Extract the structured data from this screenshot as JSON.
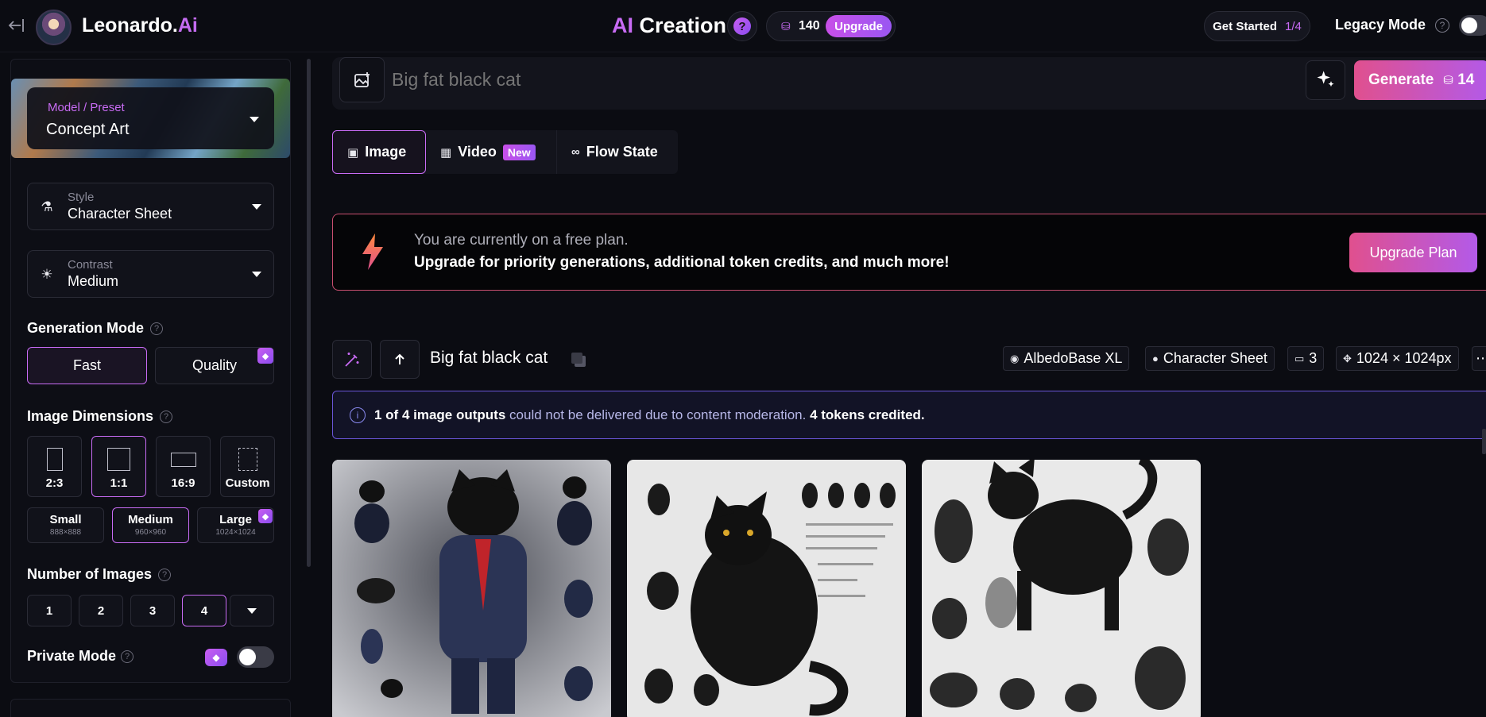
{
  "header": {
    "brand": "Leonardo.",
    "brand_ai": "Ai",
    "title_prefix": "AI",
    "title_main": "Creation",
    "help_label": "?",
    "tokens": "140",
    "upgrade_label": "Upgrade",
    "get_started": "Get Started",
    "get_started_progress": "1/4",
    "legacy_mode": "Legacy Mode"
  },
  "sidebar": {
    "preset_label": "Model / Preset",
    "preset_value": "Concept Art",
    "style_label": "Style",
    "style_value": "Character Sheet",
    "contrast_label": "Contrast",
    "contrast_value": "Medium",
    "generation_mode_title": "Generation Mode",
    "mode_fast": "Fast",
    "mode_quality": "Quality",
    "image_dimensions_title": "Image Dimensions",
    "ratios": [
      "2:3",
      "1:1",
      "16:9",
      "Custom"
    ],
    "sizes": [
      {
        "label": "Small",
        "sub": "888×888"
      },
      {
        "label": "Medium",
        "sub": "960×960"
      },
      {
        "label": "Large",
        "sub": "1024×1024"
      }
    ],
    "number_of_images_title": "Number of Images",
    "numbers": [
      "1",
      "2",
      "3",
      "4"
    ],
    "private_mode": "Private Mode"
  },
  "prompt": {
    "placeholder": "Big fat black cat",
    "generate_label": "Generate",
    "generate_cost": "14"
  },
  "tabs": {
    "image": "Image",
    "video": "Video",
    "video_badge": "New",
    "flow": "Flow State"
  },
  "banner": {
    "line1": "You are currently on a free plan.",
    "line2": "Upgrade for priority generations, additional token credits, and much more!",
    "button": "Upgrade Plan"
  },
  "generation": {
    "prompt": "Big fat black cat",
    "model": "AlbedoBase XL",
    "style": "Character Sheet",
    "count": "3",
    "dimensions": "1024 × 1024px",
    "notice_strong1": "1 of 4 image outputs",
    "notice_mid": "could not be delivered due to content moderation.",
    "notice_strong2": "4 tokens credited."
  },
  "colors": {
    "accent": "#c86bf4",
    "gradient_start": "#e0508e",
    "gradient_end": "#b35ae8"
  }
}
